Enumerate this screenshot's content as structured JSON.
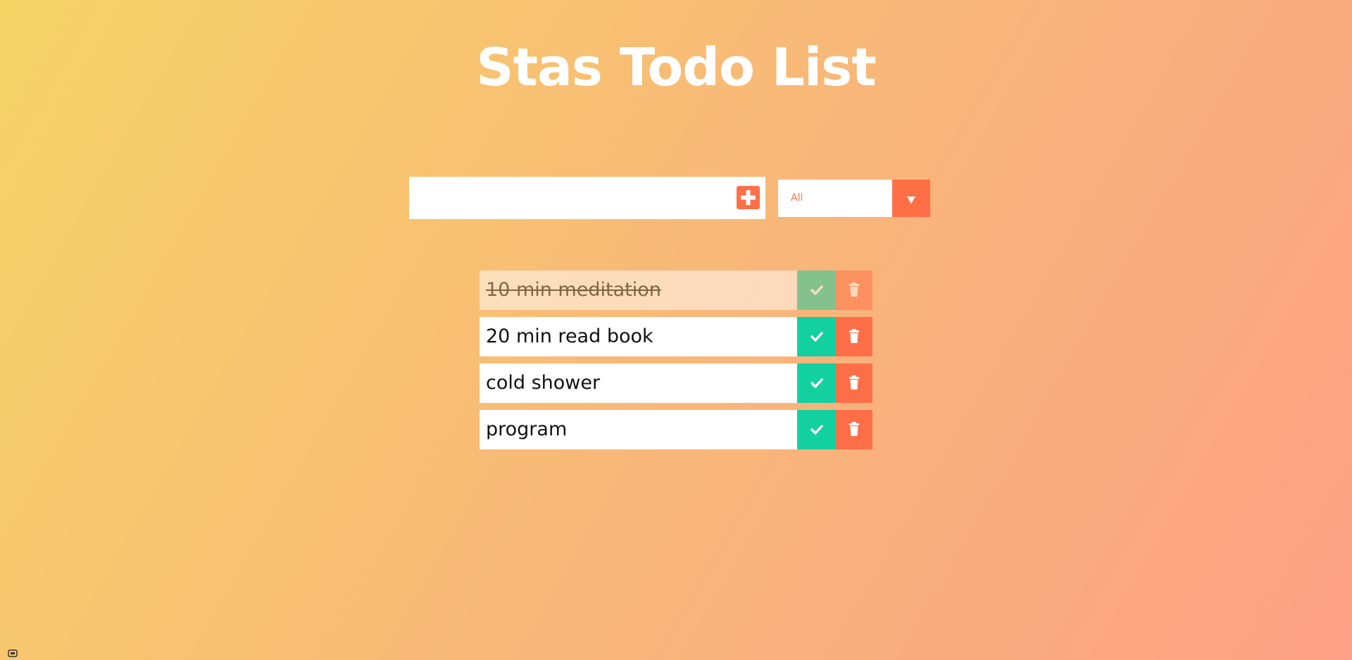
{
  "app": {
    "title": "Stas Todo List"
  },
  "add_form": {
    "input_value": "",
    "input_placeholder": "",
    "add_button_icon": "plus-icon"
  },
  "filter": {
    "selected": "All",
    "arrow_icon": "chevron-down-icon"
  },
  "todos": [
    {
      "text": "10 min meditation",
      "completed": true
    },
    {
      "text": "20 min read book",
      "completed": false
    },
    {
      "text": "cold shower",
      "completed": false
    },
    {
      "text": "program",
      "completed": false
    }
  ],
  "colors": {
    "accent": "#ff6f47",
    "complete": "#12d0a0",
    "background_start": "#f6d365",
    "background_end": "#fda085"
  },
  "icons": {
    "complete": "check-icon",
    "delete": "trash-icon"
  }
}
